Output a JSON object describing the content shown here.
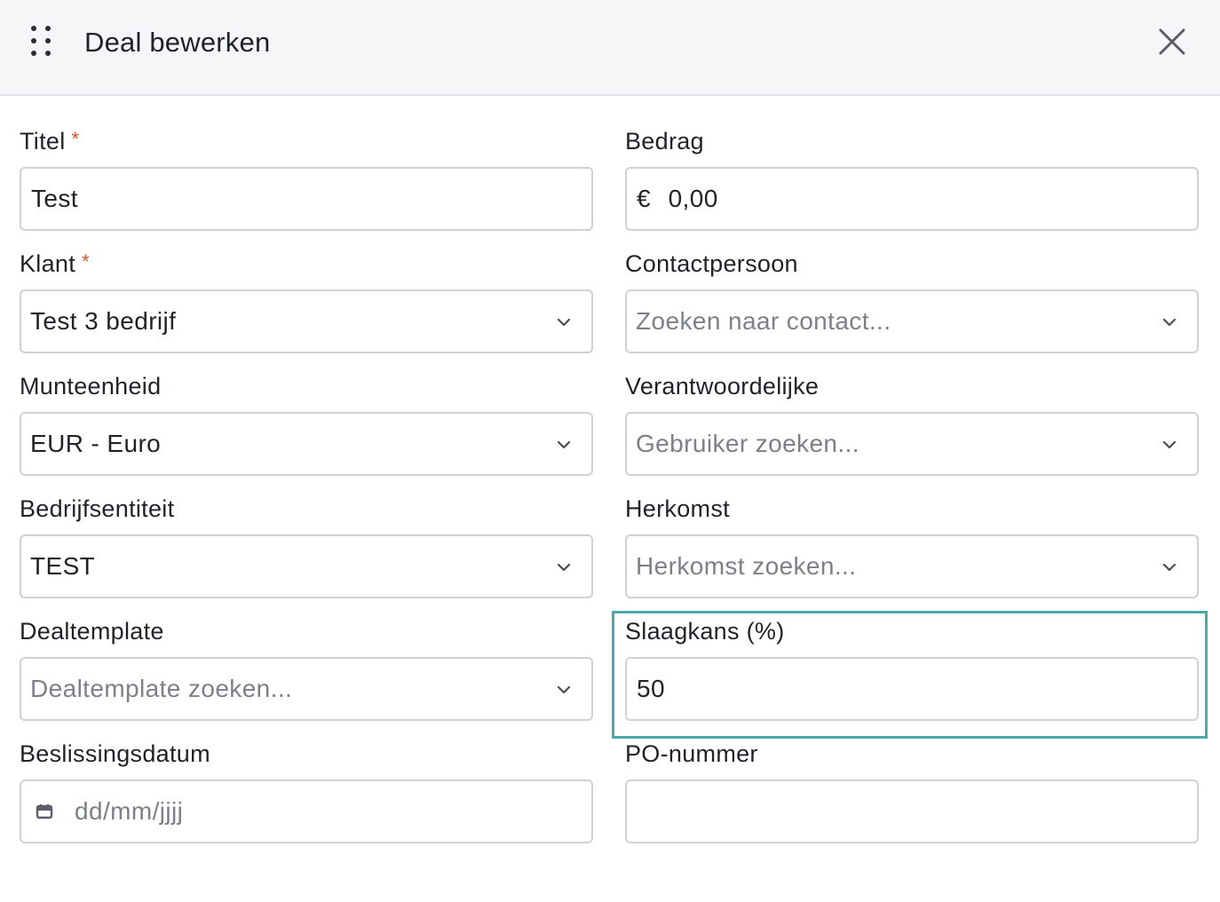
{
  "dialog": {
    "title": "Deal bewerken",
    "icons": {
      "drag": "drag-handle-icon",
      "close": "close-icon"
    }
  },
  "form": {
    "titel": {
      "label": "Titel",
      "required_mark": "*",
      "value": "Test"
    },
    "bedrag": {
      "label": "Bedrag",
      "currency_symbol": "€",
      "value": "0,00"
    },
    "klant": {
      "label": "Klant",
      "required_mark": "*",
      "value": "Test 3 bedrijf"
    },
    "contactpersoon": {
      "label": "Contactpersoon",
      "placeholder": "Zoeken naar contact..."
    },
    "munteenheid": {
      "label": "Munteenheid",
      "value": "EUR - Euro"
    },
    "verantwoordelijke": {
      "label": "Verantwoordelijke",
      "placeholder": "Gebruiker zoeken..."
    },
    "bedrijfsentiteit": {
      "label": "Bedrijfsentiteit",
      "value": "TEST"
    },
    "herkomst": {
      "label": "Herkomst",
      "placeholder": "Herkomst zoeken..."
    },
    "dealtemplate": {
      "label": "Dealtemplate",
      "placeholder": "Dealtemplate zoeken..."
    },
    "slaagkans": {
      "label": "Slaagkans (%)",
      "value": "50"
    },
    "beslissingsdatum": {
      "label": "Beslissingsdatum",
      "placeholder": "dd/mm/jjjj"
    },
    "po_nummer": {
      "label": "PO-nummer",
      "value": ""
    }
  },
  "colors": {
    "required": "#d0542a",
    "highlight": "#4aa9a9",
    "header_bg": "#f6f6f8",
    "border": "#cfd1d6",
    "placeholder": "#7c8088"
  }
}
